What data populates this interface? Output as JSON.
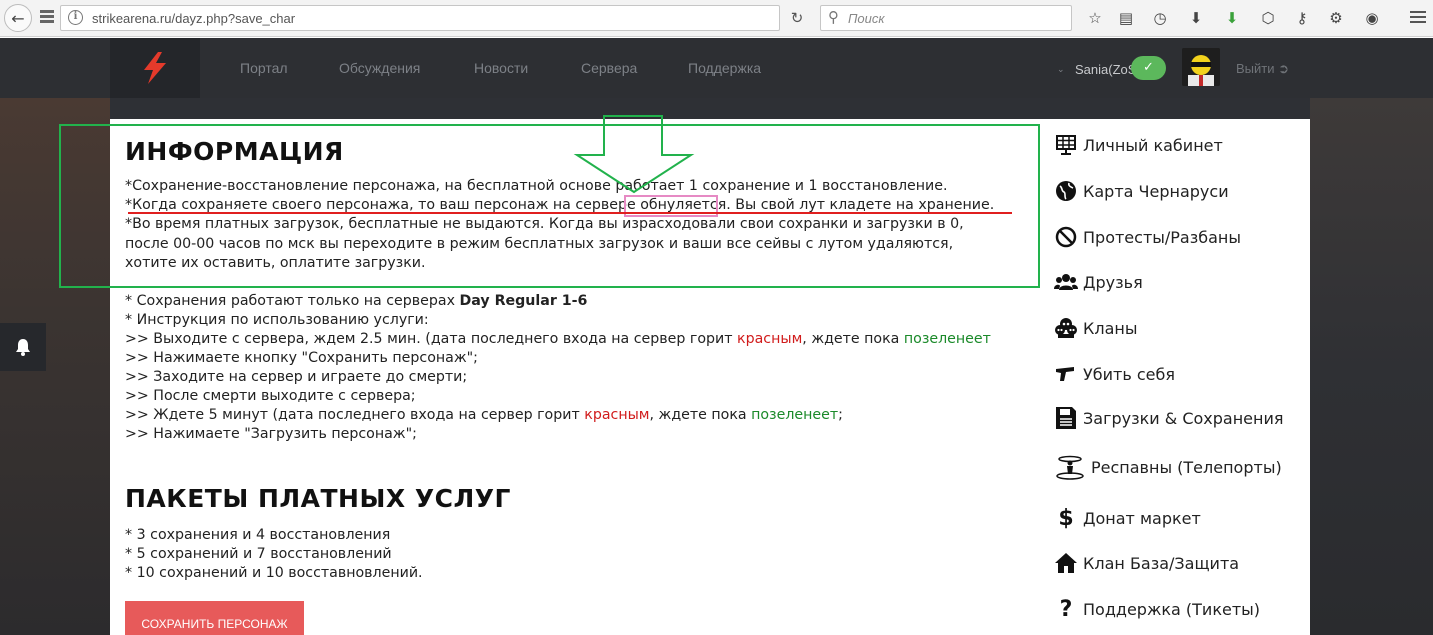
{
  "browser": {
    "url": "strikearena.ru/dayz.php?save_char",
    "search_placeholder": "Поиск"
  },
  "header": {
    "nav": [
      "Портал",
      "Обсуждения",
      "Новости",
      "Сервера",
      "Поддержка"
    ],
    "user_name": "Sania(ZoS)",
    "logout_label": "Выйти"
  },
  "info": {
    "title": "ИНФОРМАЦИЯ",
    "line1": "*Сохранение-восстановление персонажа, на бесплатной основе работает 1 сохранение и 1 восстановление.",
    "line2": "*Когда сохраняете своего персонажа, то ваш персонаж на сервере обнуляется. Вы свой лут кладете на хранение.",
    "line3": "*Во время платных загрузок, бесплатные не выдаются. Когда вы израсходовали свои сохранки и загрузки в 0,",
    "line4": "после 00-00 часов по мск вы переходите в режим бесплатных загрузок и ваши все сейвы с лутом удаляются,",
    "line5": "хотите их оставить, оплатите загрузки.",
    "servers_prefix": "* Сохранения работают только на серверах ",
    "servers_bold": "Day Regular 1-6",
    "instr_title": "* Инструкция по использованию услуги:",
    "step1_a": ">> Выходите с сервера, ждем 2.5 мин. (дата последнего входа на сервер горит ",
    "step1_red": "красным",
    "step1_b": ", ждете пока ",
    "step1_green": "позеленеет",
    "step2": ">> Нажимаете кнопку \"Сохранить персонаж\";",
    "step3": ">> Заходите на сервер и играете до смерти;",
    "step4": ">> После смерти выходите с сервера;",
    "step5_a": ">> Ждете 5 минут (дата последнего входа на сервер горит ",
    "step5_red": "красным",
    "step5_b": ", ждете пока ",
    "step5_green": "позеленеет",
    "step5_c": ";",
    "step6": ">> Нажимаете \"Загрузить персонаж\";"
  },
  "packs": {
    "title": "ПАКЕТЫ ПЛАТНЫХ УСЛУГ",
    "items": [
      "* 3 сохранения и 4 восстановления",
      "* 5 сохранений и 7 восстановлений",
      "* 10 сохранений и 10 восставновлений."
    ]
  },
  "save_button": "СОХРАНИТЬ ПЕРСОНАЖ",
  "sidebar": [
    {
      "label": "Личный кабинет",
      "icon": "solar-panel-icon"
    },
    {
      "label": "Карта Чернаруси",
      "icon": "globe-icon"
    },
    {
      "label": "Протесты/Разбаны",
      "icon": "ban-icon"
    },
    {
      "label": "Друзья",
      "icon": "users-icon"
    },
    {
      "label": "Кланы",
      "icon": "skulls-icon"
    },
    {
      "label": "Убить себя",
      "icon": "pistol-icon"
    },
    {
      "label": "Загрузки & Сохранения",
      "icon": "save-icon"
    },
    {
      "label": "Респавны (Телепорты)",
      "icon": "teleport-icon"
    },
    {
      "label": "Донат маркет",
      "icon": "dollar-icon"
    },
    {
      "label": "Клан База/Защита",
      "icon": "home-icon"
    },
    {
      "label": "Поддержка (Тикеты)",
      "icon": "question-icon"
    }
  ],
  "colors": {
    "accent_red": "#e75a5a",
    "success_green": "#5cb85c",
    "annotation_green": "#22b24c",
    "text_red": "#d11c1c",
    "text_green": "#1b8a2a"
  }
}
